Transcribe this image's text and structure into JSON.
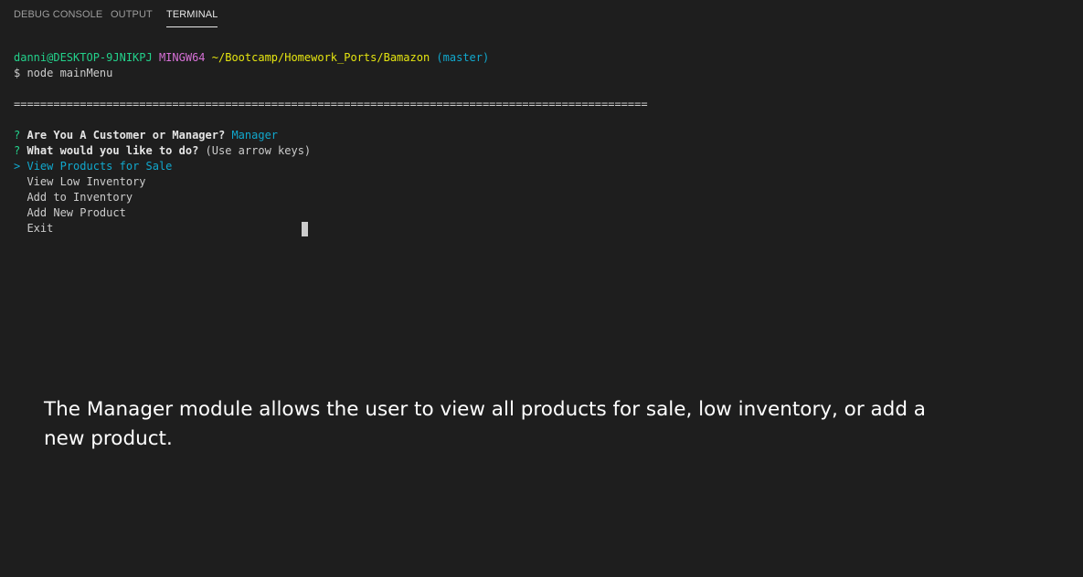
{
  "tabs": {
    "debug_console": "DEBUG CONSOLE",
    "output": "OUTPUT",
    "terminal": "TERMINAL"
  },
  "terminal": {
    "prompt_user": "danni@DESKTOP-9JNIKPJ",
    "prompt_env": "MINGW64",
    "prompt_path": "~/Bootcamp/Homework_Ports/Bamazon",
    "prompt_branch": "(master)",
    "command": "$ node mainMenu",
    "separator": "================================================================================================",
    "q1_mark": "?",
    "q1_text": "Are You A Customer or Manager?",
    "q1_answer": "Manager",
    "q2_mark": "?",
    "q2_text": "What would you like to do?",
    "q2_hint": "(Use arrow keys)",
    "pointer": ">",
    "options": [
      "View Products for Sale",
      "View Low Inventory",
      "Add to Inventory",
      "Add New Product",
      "Exit"
    ]
  },
  "caption": "The Manager module allows the user to view all products for sale, low inventory, or add a new product.",
  "colors": {
    "background": "#1e1e1e",
    "prompt_user": "#23d18b",
    "prompt_env": "#d670d6",
    "prompt_path": "#e5e510",
    "accent_cyan": "#11a8cd"
  }
}
